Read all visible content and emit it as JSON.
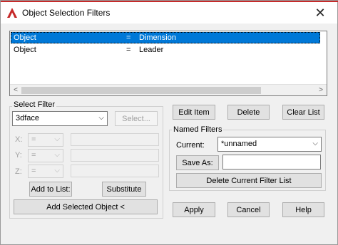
{
  "window": {
    "title": "Object Selection Filters",
    "close_glyph": "✕",
    "accent_color": "#c62a2a"
  },
  "filter_list": {
    "rows": [
      {
        "c1": "Object",
        "c2": "=",
        "c3": "Dimension",
        "selected": true
      },
      {
        "c1": "Object",
        "c2": "=",
        "c3": "Leader",
        "selected": false
      }
    ],
    "scroll_left": "<",
    "scroll_right": ">"
  },
  "select_filter": {
    "group_label": "Select Filter",
    "type_value": "3dface",
    "select_button": "Select...",
    "x_label": "X:",
    "y_label": "Y:",
    "z_label": "Z:",
    "op_value": "=",
    "add_to_list": "Add to List:",
    "substitute": "Substitute",
    "add_selected_object": "Add Selected Object <"
  },
  "list_actions": {
    "edit_item": "Edit Item",
    "delete": "Delete",
    "clear_list": "Clear List"
  },
  "named_filters": {
    "group_label": "Named Filters",
    "current_label": "Current:",
    "current_value": "*unnamed",
    "save_as": "Save As:",
    "save_as_value": "",
    "delete_current": "Delete Current Filter List"
  },
  "dialog_buttons": {
    "apply": "Apply",
    "cancel": "Cancel",
    "help": "Help"
  },
  "icons": {
    "app": "autocad-logo-icon",
    "close": "close-icon",
    "chevron": "chevron-down-icon"
  }
}
